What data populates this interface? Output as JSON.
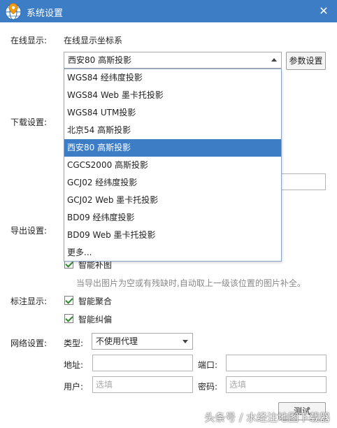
{
  "window": {
    "title": "系统设置",
    "close_glyph": "✕",
    "logo_icon": "globe-icon",
    "accent": "#3c7dc6"
  },
  "online": {
    "label": "在线显示:",
    "coord_label": "在线显示坐标系",
    "selected": "西安80 高斯投影",
    "params_button": "参数设置"
  },
  "dropdown": {
    "options": [
      "WGS84 经纬度投影",
      "WGS84 Web 墨卡托投影",
      "WGS84 UTM投影",
      "北京54 高斯投影",
      "西安80 高斯投影",
      "CGCS2000 高斯投影",
      "GCJ02 经纬度投影",
      "GCJ02 Web 墨卡托投影",
      "BD09 经纬度投影",
      "BD09 Web 墨卡托投影",
      "更多..."
    ],
    "selected_index": 4
  },
  "download": {
    "label": "下载设置:"
  },
  "export": {
    "label": "导出设置:",
    "smart_fill": "智能补图",
    "hint": "当导出图片为空或有残缺时,自动取上一级该位置的图片补全。"
  },
  "annotation": {
    "label": "标注显示:",
    "smart_merge": "智能聚合",
    "smart_correct": "智能纠偏"
  },
  "network": {
    "label": "网络设置:",
    "type_label": "类型:",
    "type_value": "不使用代理",
    "address_label": "地址:",
    "port_label": "端口:",
    "user_label": "用户:",
    "user_placeholder": "选填",
    "password_label": "密码:",
    "password_placeholder": "选填",
    "test_button": "测试"
  },
  "watermark": "头条号 / 水经注地图下载器"
}
